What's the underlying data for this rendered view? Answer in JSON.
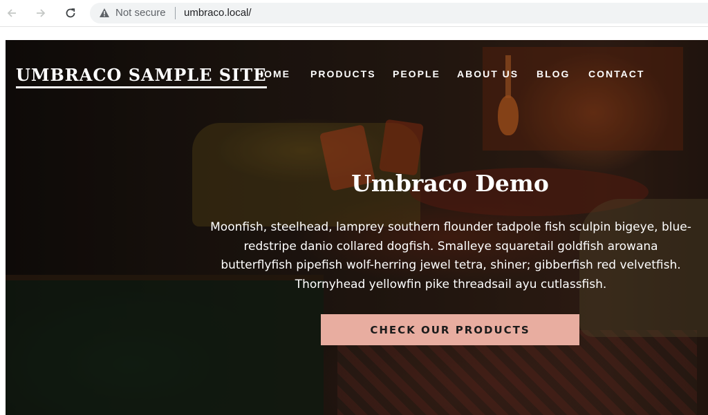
{
  "browser": {
    "security_label": "Not secure",
    "url": "umbraco.local/",
    "icons": [
      "back-arrow-icon",
      "forward-arrow-icon",
      "reload-icon",
      "warning-icon"
    ]
  },
  "site": {
    "logo": "UMBRACO SAMPLE SITE",
    "nav": [
      "HOME",
      "PRODUCTS",
      "PEOPLE",
      "ABOUT US",
      "BLOG",
      "CONTACT"
    ],
    "hero": {
      "title": "Umbraco Demo",
      "text": "Moonfish, steelhead, lamprey southern flounder tadpole fish sculpin bigeye, blue-redstripe danio collared dogfish. Smalleye squaretail goldfish arowana butterflyfish pipefish wolf-herring jewel tetra, shiner; gibberfish red velvetfish. Thornyhead yellowfin pike threadsail ayu cutlassfish.",
      "cta": "CHECK OUR PRODUCTS"
    },
    "colors": {
      "cta_background": "#e8ada0",
      "text": "#ffffff"
    }
  }
}
